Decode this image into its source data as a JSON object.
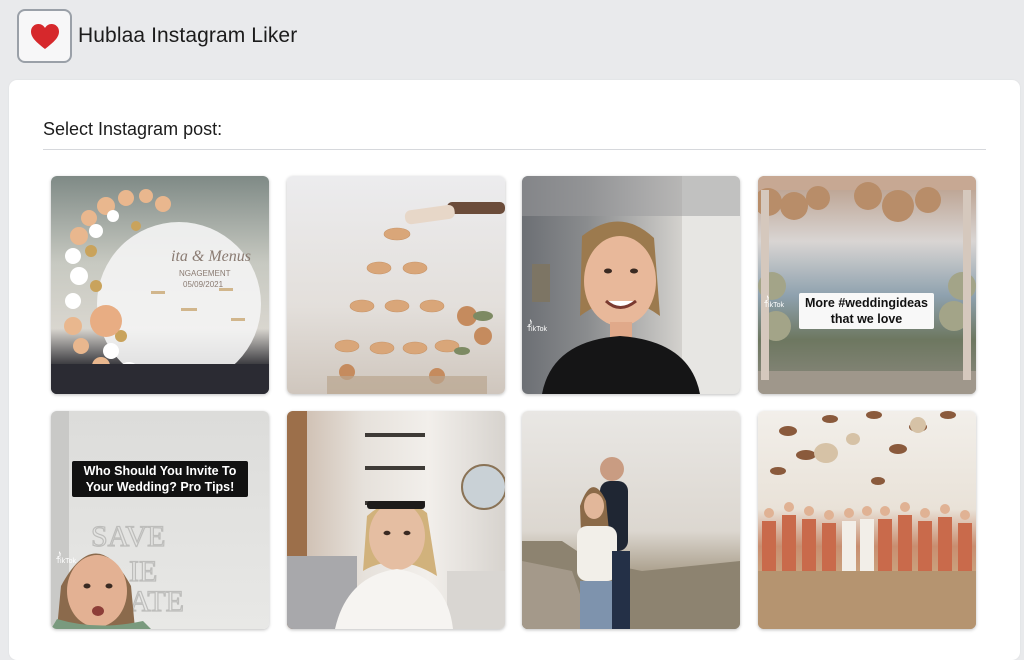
{
  "app": {
    "title": "Hublaa Instagram Liker",
    "logo_icon": "heart-icon",
    "accent_color": "#d6282c"
  },
  "main": {
    "section_title": "Select Instagram post:"
  },
  "posts": [
    {
      "id": "p1",
      "overlay_text": "",
      "tiktok": ""
    },
    {
      "id": "p2",
      "overlay_text": "",
      "tiktok": ""
    },
    {
      "id": "p3",
      "overlay_text": "",
      "tiktok": "TikTok"
    },
    {
      "id": "p4",
      "overlay_text": "More #weddingideas\nthat we love",
      "tiktok": "TikTok"
    },
    {
      "id": "p5",
      "overlay_text": "Who Should You Invite To\nYour Wedding? Pro Tips!",
      "tiktok": "TikTok"
    },
    {
      "id": "p6",
      "overlay_text": "",
      "tiktok": ""
    },
    {
      "id": "p7",
      "overlay_text": "",
      "tiktok": ""
    },
    {
      "id": "p8",
      "overlay_text": "",
      "tiktok": ""
    }
  ]
}
